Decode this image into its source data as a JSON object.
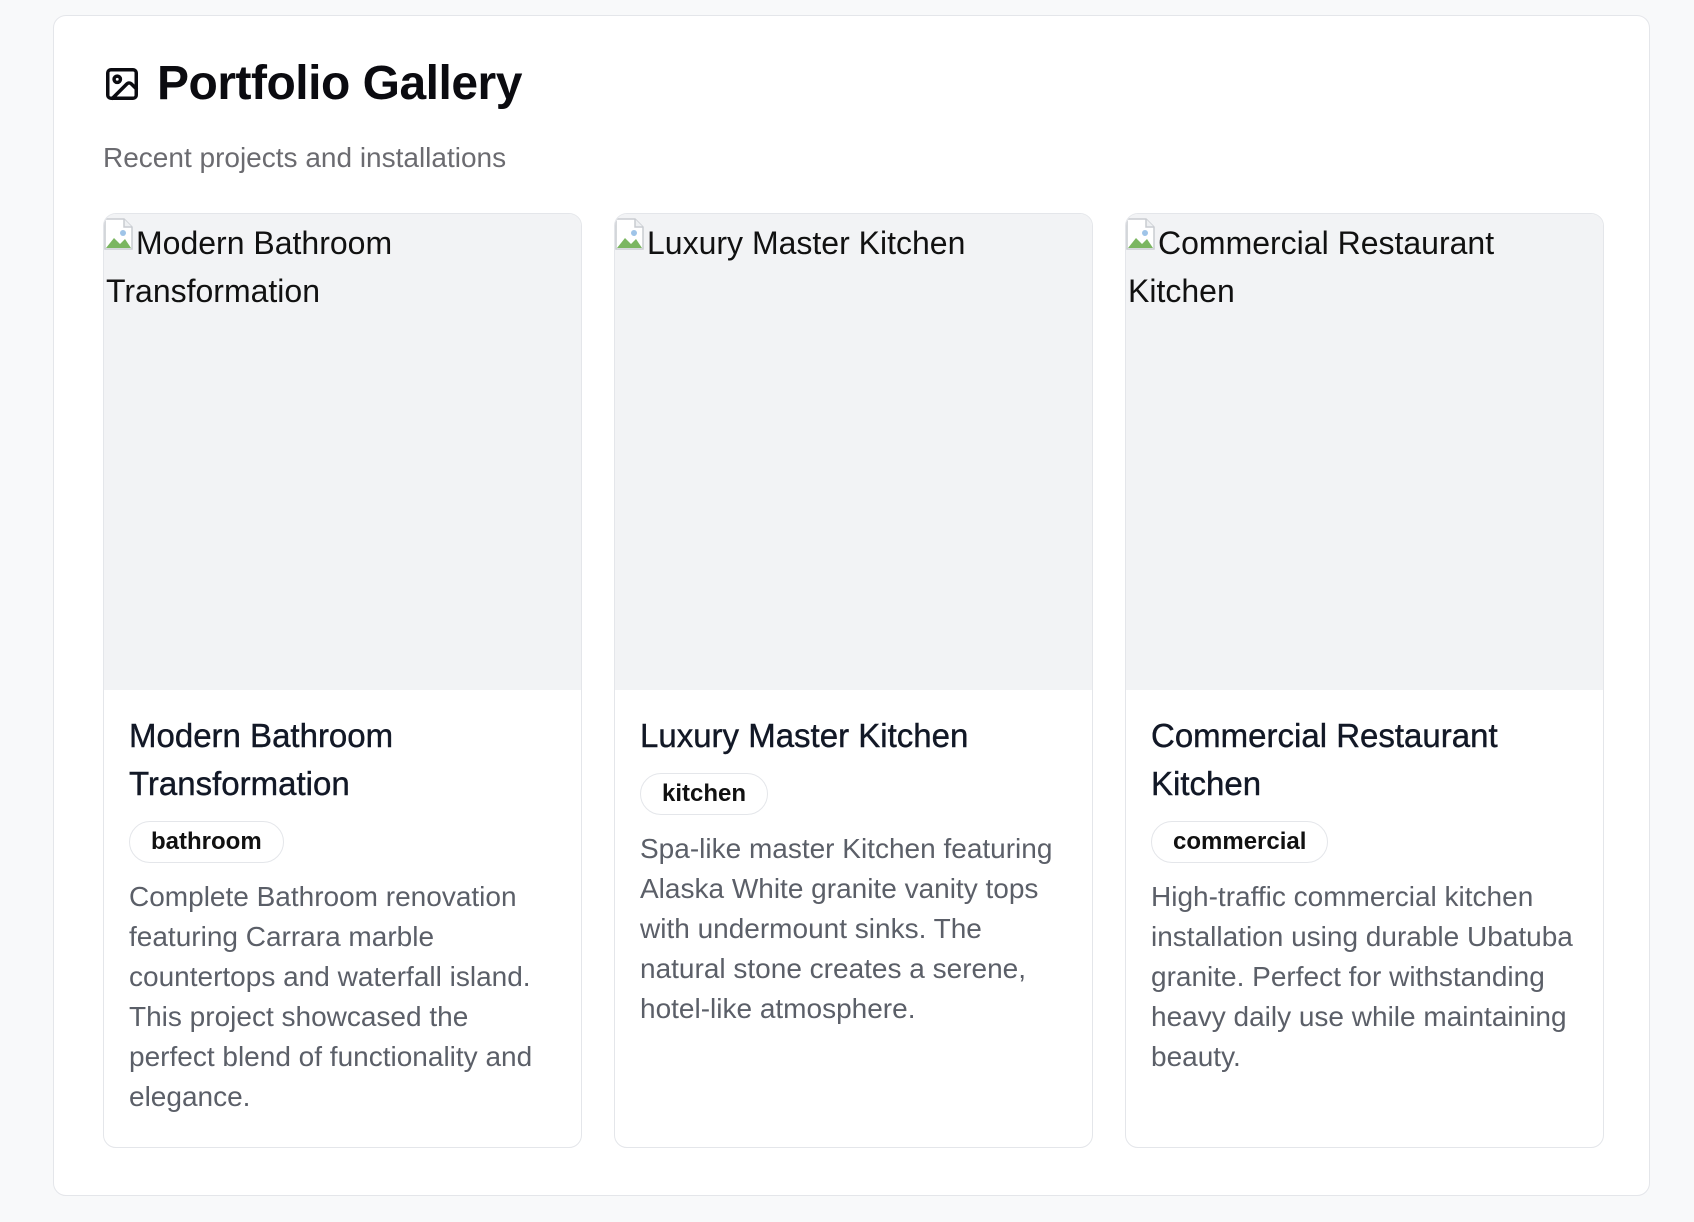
{
  "header": {
    "title": "Portfolio Gallery",
    "subtitle": "Recent projects and installations",
    "icon": "image-icon"
  },
  "projects": [
    {
      "image_alt": "Modern Bathroom Transformation",
      "title": "Modern Bathroom Transformation",
      "tag": "bathroom",
      "description": "Complete Bathroom renovation featuring Carrara marble countertops and waterfall island. This project showcased the perfect blend of functionality and elegance."
    },
    {
      "image_alt": "Luxury Master Kitchen",
      "title": "Luxury Master Kitchen",
      "tag": "kitchen",
      "description": "Spa-like master Kitchen featuring Alaska White granite vanity tops with undermount sinks. The natural stone creates a serene, hotel-like atmosphere."
    },
    {
      "image_alt": "Commercial Restaurant Kitchen",
      "title": "Commercial Restaurant Kitchen",
      "tag": "commercial",
      "description": "High-traffic commercial kitchen installation using durable Ubatuba granite. Perfect for withstanding heavy daily use while maintaining beauty."
    }
  ]
}
